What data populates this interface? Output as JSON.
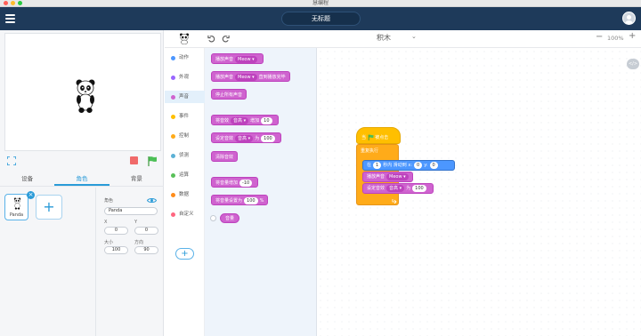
{
  "window": {
    "title": "慧编程"
  },
  "header": {
    "project_title": "无标题"
  },
  "stage_tabs": [
    "设备",
    "角色",
    "背景"
  ],
  "sprite": {
    "name": "Panda"
  },
  "properties": {
    "sprite_label": "角色",
    "sprite_name": "Panda",
    "x_label": "X",
    "x_value": "0",
    "y_label": "Y",
    "y_value": "0",
    "size_label": "大小",
    "size_value": "100",
    "direction_label": "方向",
    "direction_value": "90"
  },
  "toolbar": {
    "mode": "积木",
    "zoom": "100%"
  },
  "categories": [
    {
      "label": "动作",
      "color": "#4c97ff"
    },
    {
      "label": "外观",
      "color": "#9966ff"
    },
    {
      "label": "声音",
      "color": "#cf63cf"
    },
    {
      "label": "事件",
      "color": "#ffbf00"
    },
    {
      "label": "控制",
      "color": "#ffab19"
    },
    {
      "label": "侦测",
      "color": "#5cb1d6"
    },
    {
      "label": "运算",
      "color": "#59c059"
    },
    {
      "label": "数据",
      "color": "#ff8c1a"
    },
    {
      "label": "自定义",
      "color": "#ff6680"
    }
  ],
  "palette": {
    "play_sound": "播放声音",
    "sound_name": "Meow",
    "play_until_done_suffix": "直到播放完毕",
    "stop_all_sounds": "停止所有声音",
    "change_effect": "将音效",
    "effect_pitch": "音高",
    "change_by": "增加",
    "change_value": "10",
    "set_effect": "设定音效",
    "set_to": "为",
    "set_value": "100",
    "clear_effects": "清除音效",
    "change_volume": "将音量增加",
    "volume_change_value": "-10",
    "set_volume": "将音量设置为",
    "volume_value": "100",
    "volume_unit": "%",
    "volume_reporter": "音量"
  },
  "script": {
    "hat_label": "当",
    "hat_suffix": "被点击",
    "forever": "重复执行",
    "glide_prefix": "在",
    "glide_secs": "1",
    "glide_mid": "秒内 滑动到 x:",
    "glide_x": "0",
    "glide_y_label": "y:",
    "glide_y": "0",
    "play_sound": "播放声音",
    "sound_name": "Meow",
    "set_effect": "设定音效",
    "effect_pitch": "音高",
    "set_to": "为",
    "set_value": "100"
  }
}
